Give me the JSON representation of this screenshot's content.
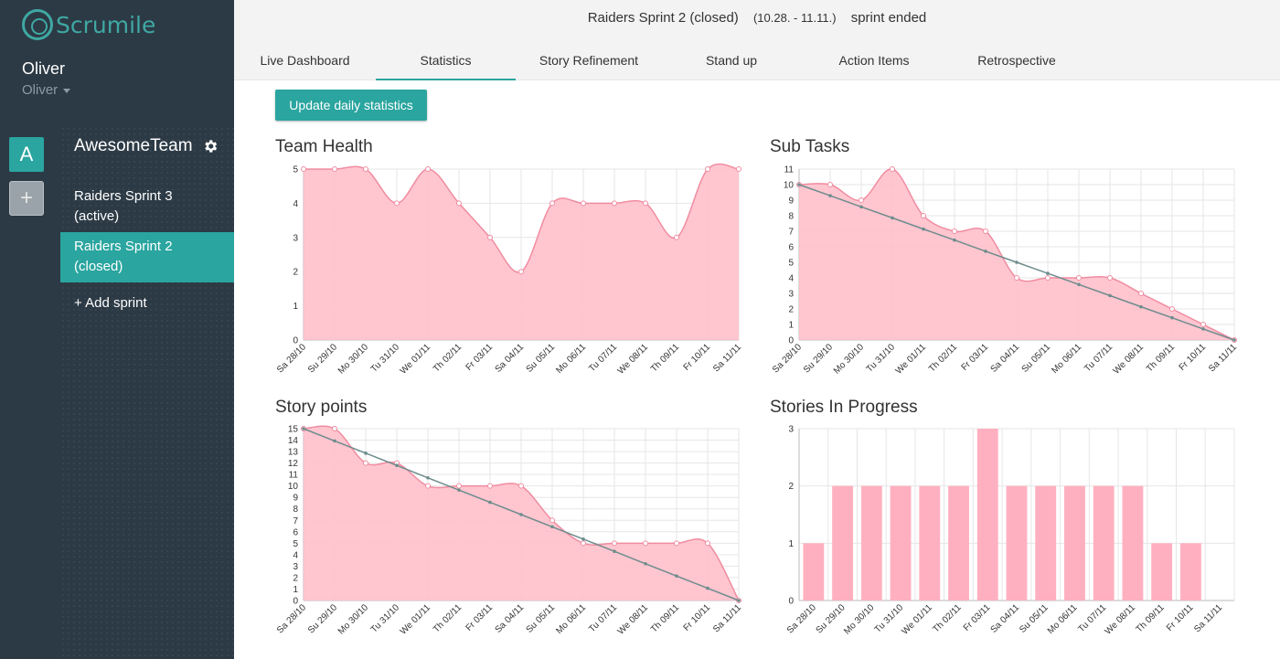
{
  "app": {
    "name": "Scrumile"
  },
  "user": {
    "name": "Oliver",
    "account": "Oliver"
  },
  "teams": {
    "avatar_letter": "A",
    "add_symbol": "+"
  },
  "team": {
    "name": "AwesomeTeam"
  },
  "sprints": [
    {
      "line1": "Raiders Sprint 3",
      "line2": "(active)"
    },
    {
      "line1": "Raiders Sprint 2",
      "line2": "(closed)"
    }
  ],
  "add_sprint_label": "+ Add sprint",
  "header": {
    "sprint_name": "Raiders Sprint 2 (closed)",
    "dates": "(10.28. - 11.11.)",
    "status": "sprint ended"
  },
  "tabs": [
    "Live Dashboard",
    "Statistics",
    "Story Refinement",
    "Stand up",
    "Action Items",
    "Retrospective"
  ],
  "active_tab": "Statistics",
  "update_button": "Update daily statistics",
  "colors": {
    "accent": "#2aa59f",
    "sidebar": "#2c3a45",
    "area_fill": "#ffc0cb",
    "area_line": "#f08ca0",
    "ideal_line": "#6e8c8c"
  },
  "chart_data": [
    {
      "type": "area",
      "title": "Team Health",
      "categories": [
        "Sa 28/10",
        "Su 29/10",
        "Mo 30/10",
        "Tu 31/10",
        "We 01/11",
        "Th 02/11",
        "Fr 03/11",
        "Sa 04/11",
        "Su 05/11",
        "Mo 06/11",
        "Tu 07/11",
        "We 08/11",
        "Th 09/11",
        "Fr 10/11",
        "Sa 11/11"
      ],
      "series": [
        {
          "values": [
            5,
            5,
            5,
            4,
            5,
            4,
            3,
            2,
            4,
            4,
            4,
            4,
            3,
            5,
            5
          ]
        }
      ],
      "ylim": [
        0,
        5
      ],
      "yticks": [
        0,
        1,
        2,
        3,
        4,
        5
      ],
      "grid": true
    },
    {
      "type": "area",
      "title": "Sub Tasks",
      "categories": [
        "Sa 28/10",
        "Su 29/10",
        "Mo 30/10",
        "Tu 31/10",
        "We 01/11",
        "Th 02/11",
        "Fr 03/11",
        "Sa 04/11",
        "Su 05/11",
        "Mo 06/11",
        "Tu 07/11",
        "We 08/11",
        "Th 09/11",
        "Fr 10/11",
        "Sa 11/11"
      ],
      "series": [
        {
          "values": [
            10,
            10,
            9,
            11,
            8,
            7,
            7,
            4,
            4,
            4,
            4,
            3,
            2,
            1,
            0
          ]
        },
        {
          "values": [
            10,
            9.29,
            8.57,
            7.86,
            7.14,
            6.43,
            5.71,
            5,
            4.29,
            3.57,
            2.86,
            2.14,
            1.43,
            0.71,
            0
          ]
        }
      ],
      "ylim": [
        0,
        11
      ],
      "yticks": [
        0,
        1,
        2,
        3,
        4,
        5,
        6,
        7,
        8,
        9,
        10,
        11
      ],
      "grid": true
    },
    {
      "type": "area",
      "title": "Story points",
      "categories": [
        "Sa 28/10",
        "Su 29/10",
        "Mo 30/10",
        "Tu 31/10",
        "We 01/11",
        "Th 02/11",
        "Fr 03/11",
        "Sa 04/11",
        "Su 05/11",
        "Mo 06/11",
        "Tu 07/11",
        "We 08/11",
        "Th 09/11",
        "Fr 10/11",
        "Sa 11/11"
      ],
      "series": [
        {
          "values": [
            15,
            15,
            12,
            12,
            10,
            10,
            10,
            10,
            7,
            5,
            5,
            5,
            5,
            5,
            0
          ]
        },
        {
          "values": [
            15,
            13.93,
            12.86,
            11.79,
            10.71,
            9.64,
            8.57,
            7.5,
            6.43,
            5.36,
            4.29,
            3.21,
            2.14,
            1.07,
            0
          ]
        }
      ],
      "ylim": [
        0,
        15
      ],
      "yticks": [
        0,
        1,
        2,
        3,
        4,
        5,
        6,
        7,
        8,
        9,
        10,
        11,
        12,
        13,
        14,
        15
      ],
      "grid": true
    },
    {
      "type": "bar",
      "title": "Stories In Progress",
      "categories": [
        "Sa 28/10",
        "Su 29/10",
        "Mo 30/10",
        "Tu 31/10",
        "We 01/11",
        "Th 02/11",
        "Fr 03/11",
        "Sa 04/11",
        "Su 05/11",
        "Mo 06/11",
        "Tu 07/11",
        "We 08/11",
        "Th 09/11",
        "Fr 10/11",
        "Sa 11/11"
      ],
      "series": [
        {
          "values": [
            1,
            2,
            2,
            2,
            2,
            2,
            3,
            2,
            2,
            2,
            2,
            2,
            1,
            1,
            0
          ]
        }
      ],
      "ylim": [
        0,
        3
      ],
      "yticks": [
        0,
        1,
        2,
        3
      ],
      "grid": true
    }
  ]
}
